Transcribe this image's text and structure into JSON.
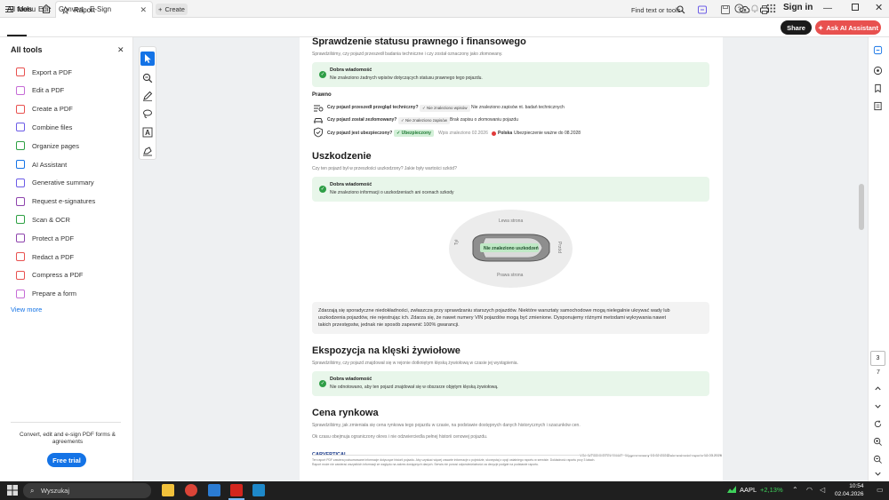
{
  "titlebar": {
    "menu_label": "Menu",
    "tab_title": "Raport",
    "create_label": "Create",
    "signin_label": "Sign in"
  },
  "toolbar": {
    "tabs": [
      "All tools",
      "Edit",
      "Convert",
      "E-Sign"
    ],
    "find_label": "Find text or tools",
    "share_label": "Share",
    "ai_label": "Ask AI Assistant"
  },
  "leftpanel": {
    "title": "All tools",
    "tools": [
      {
        "label": "Export a PDF",
        "color": "#e8514f"
      },
      {
        "label": "Edit a PDF",
        "color": "#c66bd6"
      },
      {
        "label": "Create a PDF",
        "color": "#e8514f"
      },
      {
        "label": "Combine files",
        "color": "#6c5ce7"
      },
      {
        "label": "Organize pages",
        "color": "#2ea043"
      },
      {
        "label": "AI Assistant",
        "color": "#1473e6"
      },
      {
        "label": "Generative summary",
        "color": "#6c5ce7"
      },
      {
        "label": "Request e-signatures",
        "color": "#8e44ad"
      },
      {
        "label": "Scan & OCR",
        "color": "#2ea043"
      },
      {
        "label": "Protect a PDF",
        "color": "#8e44ad"
      },
      {
        "label": "Redact a PDF",
        "color": "#e8514f"
      },
      {
        "label": "Compress a PDF",
        "color": "#e8514f"
      },
      {
        "label": "Prepare a form",
        "color": "#c66bd6"
      }
    ],
    "view_more": "View more",
    "promo_text": "Convert, edit and e-sign PDF forms & agreements",
    "free_trial": "Free trial"
  },
  "document": {
    "sec1": {
      "title": "Sprawdzenie statusu prawnego i finansowego",
      "subtitle": "Sprawdziliśmy, czy pojazd przeszedł badania techniczne i czy został oznaczony jako złomowany.",
      "good_title": "Dobra wiadomość",
      "good_text": "Nie znaleziono żadnych wpisów dotyczących statusu prawnego tego pojazdu.",
      "prawno_label": "Prawno",
      "row1_q": "Czy pojazd przeszedł przegląd techniczny?",
      "row1_pill": "Nie znaleziono wpisów",
      "row1_text": "Nie znaleziono zapisów nt. badań technicznych",
      "row2_q": "Czy pojazd został zezłomowany?",
      "row2_pill": "Nie znaleziono zapisów",
      "row2_text": "Brak zapisu o złomowaniu pojazdu",
      "row3_q": "Czy pojazd jest ubezpieczony?",
      "row3_pill": "Ubezpieczony",
      "row3_date": "Wpis znaleziono 02.2026",
      "row3_country": "Polska",
      "row3_text": "Ubezpieczenie ważne do 08.2028"
    },
    "sec2": {
      "title": "Uszkodzenie",
      "subtitle": "Czy ten pojazd był w przeszłości uszkodzony? Jakie były wartości szkód?",
      "good_title": "Dobra wiadomość",
      "good_text": "Nie znaleziono informacji o uszkodzeniach ani ocenach szkody",
      "left_side": "Lewa strona",
      "right_side": "Prawa strona",
      "back": "Tył",
      "front": "Przód",
      "car_badge": "Nie znaleziono uszkodzeń",
      "note_line1": "Zdarzają się sporadyczne niedokładności, zwłaszcza przy sprawdzaniu starszych pojazdów. Niektóre warsztaty samochodowe mogą nielegalnie ukrywać wady lub",
      "note_line2": "uszkodzenia pojazdów, nie rejestrując ich. Zdarza się, że nawet numery VIN pojazdów mogą być zmienione. Dysponujemy różnymi metodami wykrywania nawet",
      "note_line3": "takich przestępstw, jednak nie sposób zapewnić 100% gwarancji."
    },
    "sec3": {
      "title": "Ekspozycja na klęski żywiołowe",
      "subtitle": "Sprawdziliśmy, czy pojazd znajdował się w rejonie dotkniętym klęską żywiołową w czasie jej wystąpienia.",
      "good_title": "Dobra wiadomość",
      "good_text": "Nie odnotowano, aby ten pojazd znajdował się w obszarze objętym klęską żywiołową."
    },
    "sec4": {
      "title": "Cena rynkowa",
      "subtitle": "Sprawdziliśmy, jak zmieniała się cena rynkowa tego pojazdu w czasie, na podstawie dostępnych danych historycznych i szacunków cen.",
      "text": "Ok czasu obejmuja ograniczony okres i nie odzwierciedla pełnej historii cenowej pojazdu."
    },
    "footer": {
      "brand": "CARVERTICAL",
      "vin": "VIN: WF0DXXGTELYM447",
      "generated": "Wygenerowany 13.02.2026",
      "valid": "Data ważności raportu 18.03.2026",
      "disclaimer1": "Ten raport PDF zawiera podsumowane informacje dotyczące historii pojazdu. Aby uzyskać więcej zawarte informacje o pojeździe, skorzystaj z opcji ostatniego raportu w serwisie. Dokładność raportu przy 3 latach.",
      "disclaimer2": "Raport może nie zawierać wszystkich informacji ze względu na zakres dostępnych danych. Serwis nie ponosi odpowiedzialności za decyzje podjęte na podstawie raportu."
    }
  },
  "pagenav": {
    "current": "3",
    "total": "7"
  },
  "taskbar": {
    "search": "Wyszukaj",
    "ticker": "AAPL",
    "change": "+2,13%",
    "time": "10:54",
    "date": "02.04.2026"
  }
}
